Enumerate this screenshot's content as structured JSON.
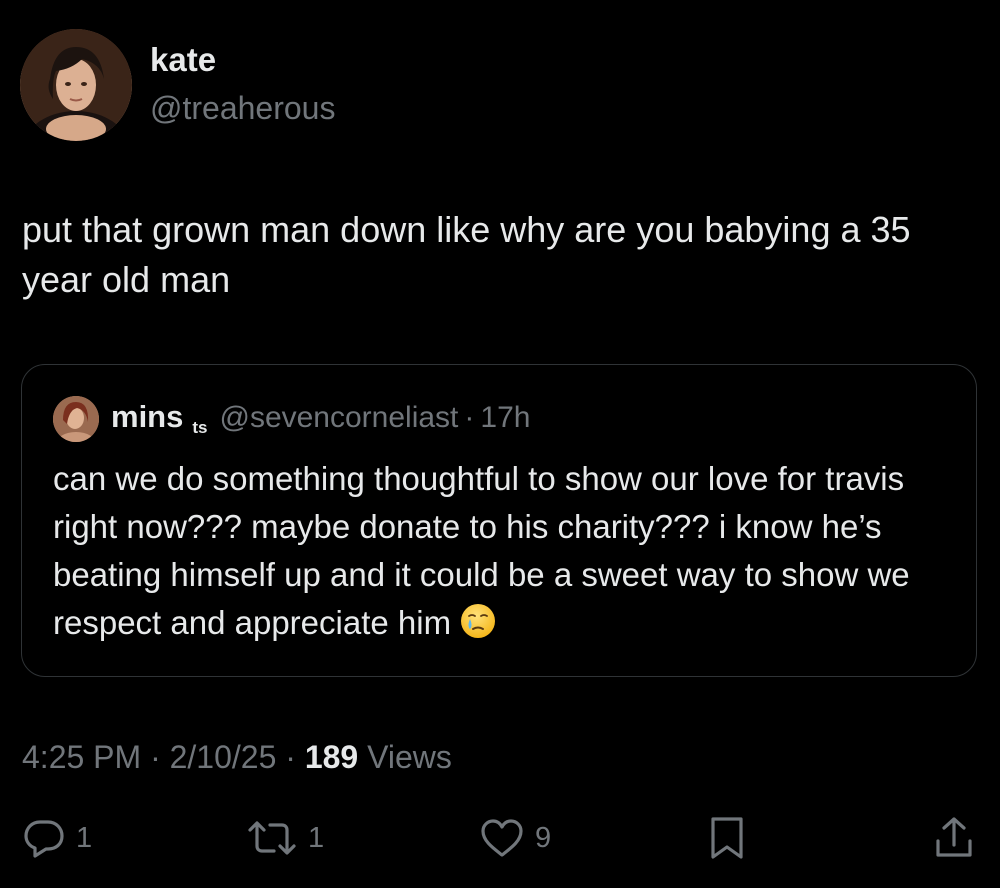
{
  "author": {
    "name": "kate",
    "handle": "@treaherous"
  },
  "tweet": {
    "text": "put that grown man down like why are you babying a 35 year old man"
  },
  "quoted": {
    "name": "mins",
    "badge": "ts",
    "handle": "@sevencorneliast",
    "separator": "·",
    "time": "17h",
    "text": "can we do something thoughtful to show our love for travis right now??? maybe donate to his charity??? i know he’s beating himself up and it could be a sweet way to show we respect and appreciate him",
    "emoji": "face-holding-back-tears"
  },
  "meta": {
    "time": "4:25 PM",
    "separator": "·",
    "date": "2/10/25",
    "views_count": "189",
    "views_label": "Views"
  },
  "actions": {
    "replies": "1",
    "reposts": "1",
    "likes": "9"
  },
  "icons": {
    "reply": "reply-icon",
    "repost": "repost-icon",
    "like": "heart-icon",
    "bookmark": "bookmark-icon",
    "share": "share-icon"
  },
  "colors": {
    "background": "#000000",
    "text_primary": "#e7e9ea",
    "text_secondary": "#71767b",
    "border": "#2f3336"
  }
}
